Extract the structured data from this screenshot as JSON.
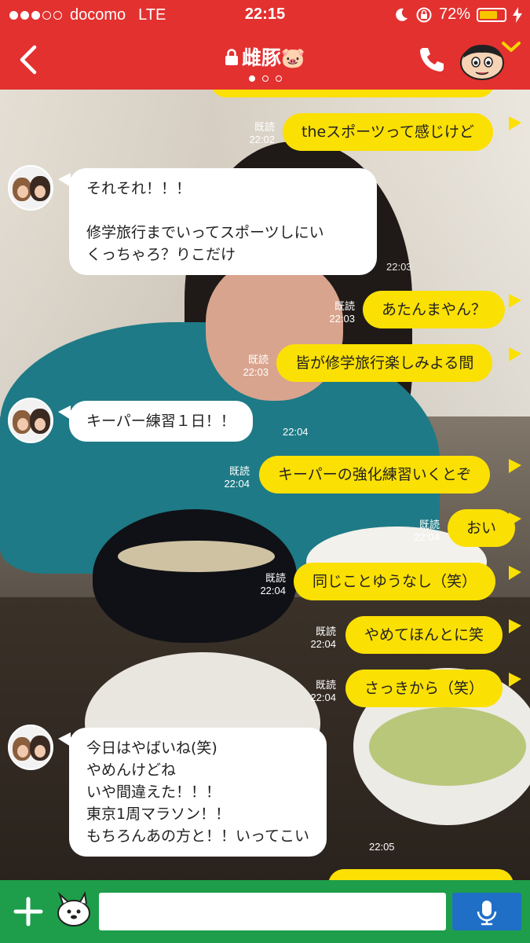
{
  "status_bar": {
    "carrier": "docomo",
    "network": "LTE",
    "time": "22:15",
    "battery": "72%",
    "battery_fraction": 0.72,
    "signal_bars_filled": 3,
    "signal_bars_total": 5
  },
  "header": {
    "title": "雌豚🐷",
    "page_indicator_count": 3,
    "page_indicator_active": 0
  },
  "colors": {
    "header_bg": "#e33130",
    "outgoing_bubble": "#fbe003",
    "incoming_bubble": "#ffffff",
    "input_bar": "#1e9e4a",
    "mic_button": "#1f6fc6"
  },
  "messages": [
    {
      "dir": "out",
      "text": "theスポーツって感じけど",
      "read": "既読",
      "time": "22:02"
    },
    {
      "dir": "in",
      "text": "それそれ！！！\n\n修学旅行までいってスポーツしにい\nくっちゃろ？りこだけ",
      "time": "22:03"
    },
    {
      "dir": "out",
      "text": "あたんまやん？",
      "read": "既読",
      "time": "22:03"
    },
    {
      "dir": "out",
      "text": "皆が修学旅行楽しみよる間",
      "read": "既読",
      "time": "22:03"
    },
    {
      "dir": "in",
      "text": "キーパー練習１日！！",
      "time": "22:04"
    },
    {
      "dir": "out",
      "text": "キーパーの強化練習いくとぞ",
      "read": "既読",
      "time": "22:04"
    },
    {
      "dir": "out",
      "text": "おい",
      "read": "既読",
      "time": "22:04"
    },
    {
      "dir": "out",
      "text": "同じことゆうなし（笑）",
      "read": "既読",
      "time": "22:04"
    },
    {
      "dir": "out",
      "text": "やめてほんとに笑",
      "read": "既読",
      "time": "22:04"
    },
    {
      "dir": "out",
      "text": "さっきから（笑）",
      "read": "既読",
      "time": "22:04"
    },
    {
      "dir": "in",
      "text": "今日はやばいね(笑)\nやめんけどね\nいや間違えた！！！\n東京1周マラソン！！\nもちろんあの方と！！いってこい",
      "time": "22:05"
    }
  ],
  "input": {
    "placeholder": "",
    "value": ""
  },
  "icons": {
    "back": "chevron-left-icon",
    "lock": "lock-icon",
    "call": "phone-icon",
    "profile": "crayon-shin-chan-avatar-icon",
    "add": "plus-icon",
    "sticker": "sticker-icon",
    "voice": "microphone-icon"
  }
}
